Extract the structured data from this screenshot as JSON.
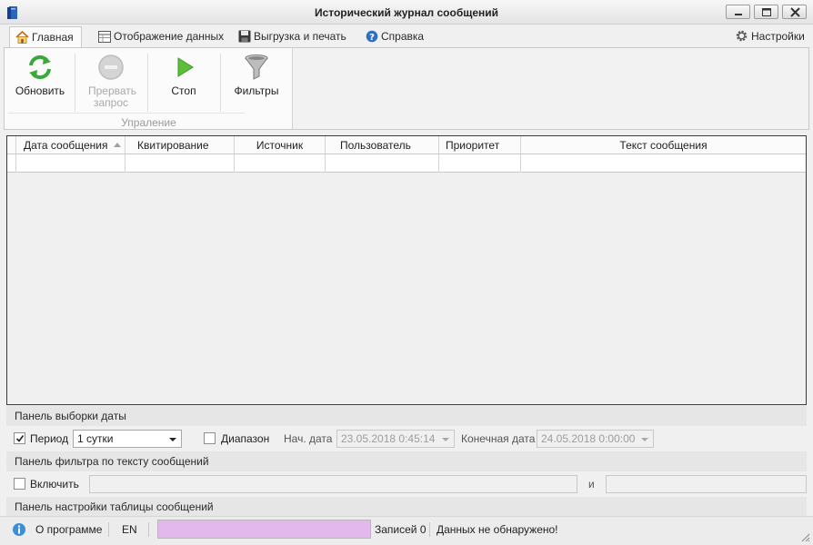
{
  "window": {
    "title": "Исторический журнал сообщений",
    "buttons": [
      "minimize",
      "maximize",
      "close"
    ]
  },
  "tabs": [
    {
      "label": "Главная",
      "icon": "home-icon",
      "active": true
    },
    {
      "label": "Отображение данных",
      "icon": "table-view-icon",
      "active": false
    },
    {
      "label": "Выгрузка и печать",
      "icon": "save-print-icon",
      "active": false
    },
    {
      "label": "Справка",
      "icon": "help-icon",
      "active": false
    }
  ],
  "settings": {
    "label": "Настройки",
    "icon": "gear-icon"
  },
  "ribbon": {
    "buttons": [
      {
        "label": "Обновить",
        "icon": "refresh-icon",
        "enabled": true
      },
      {
        "label": "Прервать запрос",
        "icon": "stop-request-icon",
        "enabled": false
      },
      {
        "label": "Стоп",
        "icon": "play-icon",
        "enabled": true
      },
      {
        "label": "Фильтры",
        "icon": "funnel-icon",
        "enabled": true
      }
    ],
    "group_label": "Упраление"
  },
  "grid": {
    "columns": [
      "Дата сообщения",
      "Квитирование",
      "Источник",
      "Пользователь",
      "Приоритет",
      "Текст сообщения"
    ],
    "sort_column": "Дата сообщения",
    "sort_direction": "ascending",
    "rows": [
      [
        "",
        "",
        "",
        "",
        "",
        ""
      ]
    ]
  },
  "date_panel": {
    "header": "Панель выборки даты",
    "period_label": "Период",
    "period_checked": true,
    "period_value": "1 сутки",
    "range_label": "Диапазон",
    "range_checked": false,
    "start_label": "Нач. дата",
    "start_value": "23.05.2018 0:45:14",
    "end_label": "Конечная дата",
    "end_value": "24.05.2018 0:00:00"
  },
  "text_panel": {
    "header": "Панель фильтра по тексту сообщений",
    "enable_label": "Включить",
    "enable_checked": false,
    "and_label": "и",
    "text1": "",
    "text2": ""
  },
  "table_panel": {
    "header": "Панель настройки таблицы сообщений"
  },
  "status": {
    "about_label": "О программе",
    "language": "EN",
    "records": "Записей 0",
    "message": "Данных не обнаружено!"
  },
  "colors": {
    "accent": "#3c8fd4",
    "progress_fill": "#e3b8ec",
    "refresh_green": "#3ba83a"
  }
}
